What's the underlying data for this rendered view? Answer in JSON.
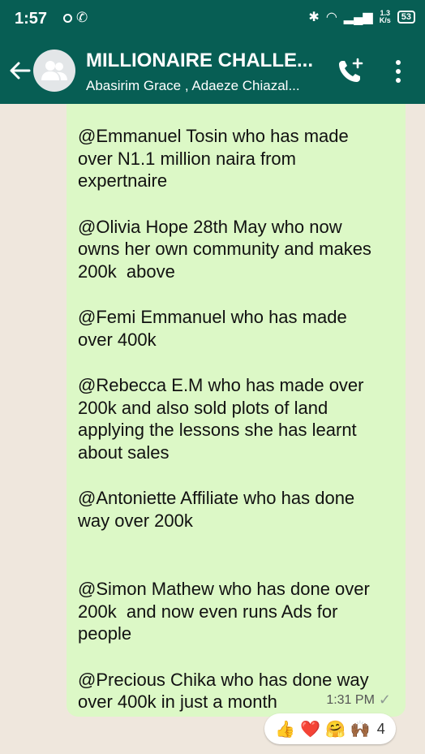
{
  "status_bar": {
    "time": "1:57",
    "network_speed_top": "1.3",
    "network_speed_bottom": "K/s",
    "battery": "53"
  },
  "header": {
    "title": "MILLIONAIRE CHALLE...",
    "subtitle": "Abasirim Grace , Adaeze Chiazal...",
    "background_color": "#075e54"
  },
  "message": {
    "paragraphs": [
      "@Emmanuel Tosin who has made\nover N1.1 million naira from\nexpertnaire",
      "@Olivia Hope 28th May who now\nowns her own community and makes\n200k  above",
      "@Femi Emmanuel who has made\nover 400k",
      "@Rebecca E.M who has made over\n200k and also sold plots of land\napplying the lessons she has learnt\nabout sales",
      "@Antoniette Affiliate who has done\nway over 200k",
      "@Simon Mathew who has done over\n200k  and now even runs Ads for\npeople",
      "@Precious Chika who has done way\nover 400k in just a month"
    ],
    "time": "1:31 PM",
    "bubble_color": "#dcf8c6"
  },
  "reactions": {
    "emojis": [
      "👍",
      "❤️",
      "🤗",
      "🙌🏾"
    ],
    "count": "4"
  },
  "icons": {
    "back": "arrow-left-icon",
    "avatar": "group-avatar-icon",
    "call": "add-call-icon",
    "menu": "more-vertical-icon"
  }
}
